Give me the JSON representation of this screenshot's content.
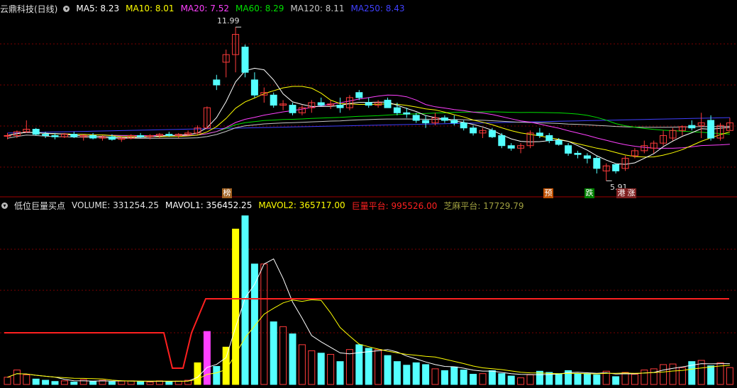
{
  "price_header": {
    "stock": "云鼎科技(日线)",
    "ma5": "MA5: 8.23",
    "ma10": "MA10: 8.01",
    "ma20": "MA20: 7.52",
    "ma60": "MA60: 8.29",
    "ma120": "MA120: 8.11",
    "ma250": "MA250: 8.43"
  },
  "volume_header": {
    "indicator": "低位巨量买点",
    "volume": "VOLUME: 331254.25",
    "mavol1": "MAVOL1: 356452.25",
    "mavol2": "MAVOL2: 365717.00",
    "platform_big": "巨量平台: 995526.00",
    "platform_small": "芝麻平台: 17729.79"
  },
  "annotations": {
    "high": "11.99",
    "low": "5.91",
    "tag_bang": "榜",
    "tag_yu": "预",
    "tag_die": "跌",
    "tag_gang": "港",
    "tag_zhang": "涨"
  },
  "colors": {
    "background": "#000000",
    "up": "#ff3b3b",
    "down": "#54ffff",
    "ma5": "#ffffff",
    "ma10": "#ffff00",
    "ma20": "#ff40ff",
    "ma60": "#00e000",
    "ma120": "#c8c8c8",
    "ma250": "#4040ff",
    "platform_big": "#ff2020",
    "grid": "#7a0000"
  },
  "chart_data": {
    "type": "candlestick",
    "ylim": [
      5.5,
      12.5
    ],
    "candles": [
      [
        7.7,
        7.8,
        7.55,
        7.7
      ],
      [
        7.7,
        7.9,
        7.6,
        7.85
      ],
      [
        7.85,
        8.3,
        7.8,
        7.95
      ],
      [
        7.95,
        8.0,
        7.7,
        7.75
      ],
      [
        7.75,
        7.85,
        7.6,
        7.7
      ],
      [
        7.7,
        7.8,
        7.55,
        7.65
      ],
      [
        7.65,
        7.8,
        7.6,
        7.75
      ],
      [
        7.75,
        7.85,
        7.6,
        7.65
      ],
      [
        7.65,
        7.75,
        7.5,
        7.7
      ],
      [
        7.7,
        7.8,
        7.55,
        7.6
      ],
      [
        7.6,
        7.7,
        7.5,
        7.65
      ],
      [
        7.65,
        7.75,
        7.5,
        7.55
      ],
      [
        7.55,
        7.65,
        7.45,
        7.6
      ],
      [
        7.6,
        7.75,
        7.55,
        7.7
      ],
      [
        7.7,
        7.8,
        7.6,
        7.65
      ],
      [
        7.65,
        7.75,
        7.55,
        7.7
      ],
      [
        7.7,
        7.8,
        7.6,
        7.75
      ],
      [
        7.75,
        7.85,
        7.65,
        7.7
      ],
      [
        7.7,
        7.8,
        7.6,
        7.75
      ],
      [
        7.75,
        7.9,
        7.7,
        7.8
      ],
      [
        7.8,
        8.1,
        7.75,
        8.0
      ],
      [
        8.0,
        8.85,
        7.95,
        8.8
      ],
      [
        9.9,
        10.1,
        9.5,
        9.7
      ],
      [
        10.6,
        11.1,
        10.0,
        10.9
      ],
      [
        10.9,
        11.99,
        10.2,
        11.7
      ],
      [
        11.2,
        11.3,
        10.0,
        10.2
      ],
      [
        9.9,
        10.2,
        9.2,
        9.3
      ],
      [
        9.3,
        9.6,
        9.0,
        9.4
      ],
      [
        9.3,
        9.4,
        8.8,
        8.9
      ],
      [
        8.9,
        9.1,
        8.7,
        8.95
      ],
      [
        8.9,
        9.0,
        8.5,
        8.6
      ],
      [
        8.6,
        8.9,
        8.5,
        8.8
      ],
      [
        8.8,
        9.1,
        8.6,
        9.0
      ],
      [
        9.0,
        9.2,
        8.85,
        8.9
      ],
      [
        8.9,
        9.1,
        8.75,
        8.95
      ],
      [
        8.9,
        9.2,
        8.6,
        8.8
      ],
      [
        8.8,
        9.3,
        8.7,
        9.2
      ],
      [
        9.4,
        9.5,
        9.1,
        9.2
      ],
      [
        9.0,
        9.2,
        8.8,
        8.9
      ],
      [
        8.9,
        9.1,
        8.8,
        9.0
      ],
      [
        9.1,
        9.2,
        8.85,
        8.8
      ],
      [
        8.8,
        9.0,
        8.5,
        8.6
      ],
      [
        8.6,
        8.8,
        8.4,
        8.55
      ],
      [
        8.5,
        8.6,
        8.2,
        8.3
      ],
      [
        8.3,
        8.5,
        8.0,
        8.2
      ],
      [
        8.2,
        8.6,
        8.1,
        8.4
      ],
      [
        8.4,
        8.5,
        8.2,
        8.3
      ],
      [
        8.3,
        8.5,
        8.1,
        8.2
      ],
      [
        8.2,
        8.3,
        7.9,
        8.0
      ],
      [
        8.0,
        8.1,
        7.7,
        7.8
      ],
      [
        7.8,
        8.0,
        7.6,
        7.9
      ],
      [
        7.9,
        8.0,
        7.6,
        7.65
      ],
      [
        7.7,
        7.8,
        7.2,
        7.3
      ],
      [
        7.3,
        7.4,
        7.1,
        7.2
      ],
      [
        7.2,
        7.4,
        7.0,
        7.3
      ],
      [
        7.3,
        7.9,
        7.2,
        7.8
      ],
      [
        7.8,
        8.0,
        7.6,
        7.7
      ],
      [
        7.7,
        7.8,
        7.4,
        7.5
      ],
      [
        7.5,
        7.6,
        7.3,
        7.35
      ],
      [
        7.3,
        7.4,
        6.9,
        7.0
      ],
      [
        7.0,
        7.1,
        6.8,
        6.95
      ],
      [
        6.9,
        7.0,
        6.6,
        6.8
      ],
      [
        6.8,
        6.9,
        6.2,
        6.4
      ],
      [
        6.3,
        6.6,
        5.91,
        6.5
      ],
      [
        6.55,
        6.6,
        6.2,
        6.3
      ],
      [
        6.4,
        6.9,
        6.3,
        6.8
      ],
      [
        6.9,
        7.2,
        6.8,
        7.1
      ],
      [
        7.1,
        7.5,
        7.0,
        7.3
      ],
      [
        7.2,
        7.5,
        7.0,
        7.4
      ],
      [
        7.4,
        7.9,
        7.3,
        7.7
      ],
      [
        7.6,
        8.0,
        7.5,
        7.9
      ],
      [
        7.9,
        8.1,
        7.7,
        8.05
      ],
      [
        8.1,
        8.3,
        7.9,
        8.0
      ],
      [
        8.1,
        8.6,
        7.6,
        8.2
      ],
      [
        8.3,
        8.5,
        7.5,
        7.6
      ],
      [
        7.6,
        8.2,
        7.5,
        8.1
      ],
      [
        7.9,
        8.4,
        7.9,
        8.2
      ]
    ],
    "volume": [
      60000,
      120000,
      80000,
      45000,
      35000,
      25000,
      30000,
      20000,
      40000,
      25000,
      35000,
      22000,
      28000,
      30000,
      25000,
      20000,
      30000,
      25000,
      28000,
      35000,
      180000,
      440000,
      150000,
      310000,
      1290000,
      1400000,
      1000000,
      1000000,
      520000,
      480000,
      420000,
      330000,
      280000,
      260000,
      250000,
      190000,
      290000,
      330000,
      300000,
      290000,
      240000,
      190000,
      160000,
      180000,
      165000,
      130000,
      115000,
      145000,
      120000,
      85000,
      90000,
      115000,
      90000,
      70000,
      55000,
      80000,
      110000,
      100000,
      90000,
      115000,
      90000,
      90000,
      80000,
      110000,
      65000,
      100000,
      85000,
      120000,
      130000,
      165000,
      170000,
      140000,
      190000,
      200000,
      155000,
      180000,
      140000
    ]
  }
}
